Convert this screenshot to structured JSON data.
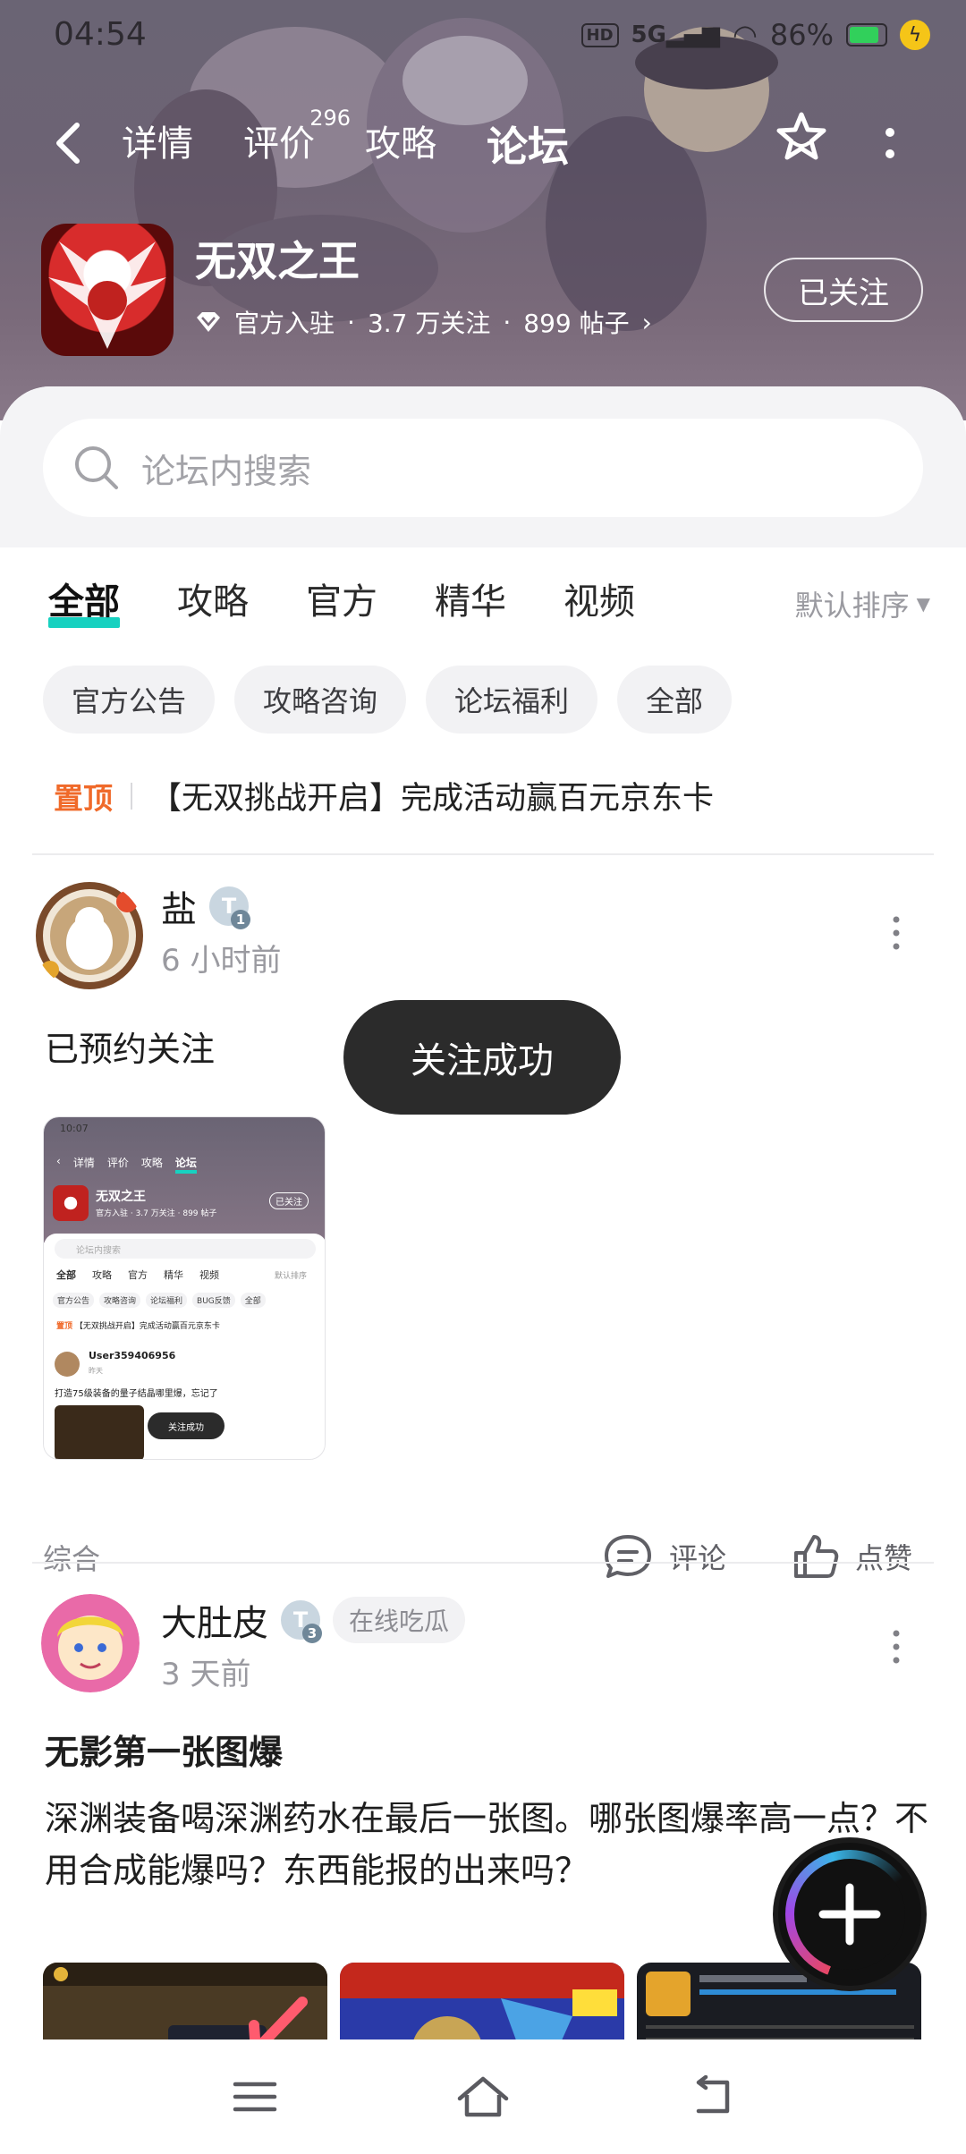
{
  "status_bar": {
    "time": "04:54",
    "hd": "HD",
    "network": "5G",
    "battery": "86%"
  },
  "nav": {
    "tabs": [
      {
        "label": "详情"
      },
      {
        "label": "评价",
        "count": "296"
      },
      {
        "label": "攻略"
      },
      {
        "label": "论坛"
      }
    ],
    "active_tab": "论坛"
  },
  "game": {
    "name": "无双之王",
    "official": "官方入驻",
    "followers": "3.7 万关注",
    "posts": "899 帖子",
    "follow_button": "已关注"
  },
  "search": {
    "placeholder": "论坛内搜索"
  },
  "filter_tabs": [
    "全部",
    "攻略",
    "官方",
    "精华",
    "视频"
  ],
  "sort": "默认排序",
  "chips": [
    "官方公告",
    "攻略咨询",
    "论坛福利",
    "全部"
  ],
  "pinned": {
    "tag": "置顶",
    "title": "【无双挑战开启】完成活动赢百元京东卡"
  },
  "posts": [
    {
      "user": "盐",
      "level": "1",
      "time": "6 小时前",
      "title": "已预约关注",
      "category": "综合",
      "comment": "评论",
      "like": "点赞"
    },
    {
      "user": "大肚皮",
      "level": "3",
      "badge": "在线吃瓜",
      "time": "3 天前",
      "title": "无影第一张图爆",
      "body": "深渊装备喝深渊药水在最后一张图。哪张图爆率高一点？不用合成能爆吗？东西能报的出来吗？"
    }
  ],
  "toast": "关注成功",
  "screenshot": {
    "time": "10:07",
    "tabs": [
      "详情",
      "评价",
      "攻略",
      "论坛"
    ],
    "game": "无双之王",
    "meta": "官方入驻 · 3.7 万关注 · 899 帖子",
    "follow": "已关注",
    "search": "论坛内搜索",
    "filters": [
      "全部",
      "攻略",
      "官方",
      "精华",
      "视频"
    ],
    "sort": "默认排序",
    "chips": [
      "官方公告",
      "攻略咨询",
      "论坛福利",
      "BUG反馈",
      "全部"
    ],
    "pinned_tag": "置顶",
    "pinned": "【无双挑战开启】完成活动赢百元京东卡",
    "user": "User359406956",
    "user_time": "昨天",
    "post": "打造75级装备的量子结晶哪里爆，忘记了",
    "toast": "关注成功"
  },
  "colors": {
    "accent": "#17d1c0",
    "pin": "#f06a2a",
    "toast_bg": "#2b2b2b"
  }
}
